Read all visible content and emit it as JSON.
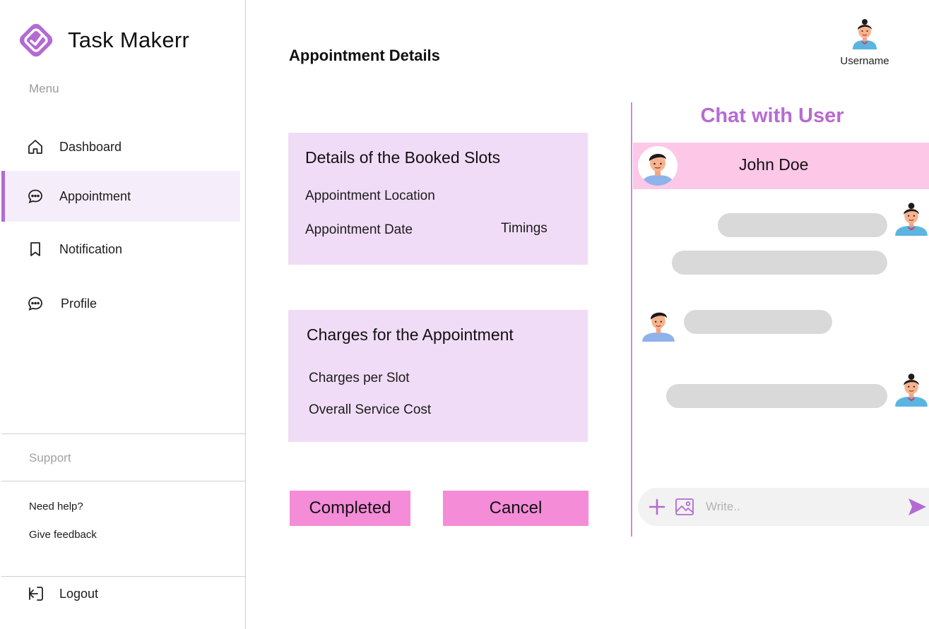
{
  "app": {
    "name": "Task Makerr"
  },
  "sidebar": {
    "menu_label": "Menu",
    "items": [
      {
        "label": "Dashboard",
        "icon": "home-icon",
        "active": false
      },
      {
        "label": "Appointment",
        "icon": "chat-bubble-icon",
        "active": true
      },
      {
        "label": "Notification",
        "icon": "bookmark-icon",
        "active": false
      },
      {
        "label": "Profile",
        "icon": "chat-bubble-icon",
        "active": false
      }
    ],
    "support_label": "Support",
    "help_links": [
      "Need help?",
      "Give feedback"
    ],
    "logout_label": "Logout"
  },
  "header": {
    "title": "Appointment Details",
    "username": "Username"
  },
  "booked_slots": {
    "title": "Details of the Booked Slots",
    "location_label": "Appointment Location",
    "date_label": "Appointment Date",
    "timings_label": "Timings"
  },
  "charges": {
    "title": "Charges for the Appointment",
    "per_slot_label": "Charges per Slot",
    "overall_label": "Overall Service Cost"
  },
  "actions": {
    "completed_label": "Completed",
    "cancel_label": "Cancel"
  },
  "chat": {
    "title": "Chat with User",
    "user_name": "John Doe",
    "input_placeholder": "Write..",
    "messages": [
      {
        "sender": "self"
      },
      {
        "sender": "self"
      },
      {
        "sender": "other"
      },
      {
        "sender": "self"
      }
    ]
  },
  "colors": {
    "accent": "#b36bd3",
    "card_bg": "#f0dcf6",
    "button_bg": "#f48cd8",
    "chat_title": "#b86ad2",
    "chat_user_bar": "#fdc7e8",
    "bubble": "#d9d9d9"
  }
}
